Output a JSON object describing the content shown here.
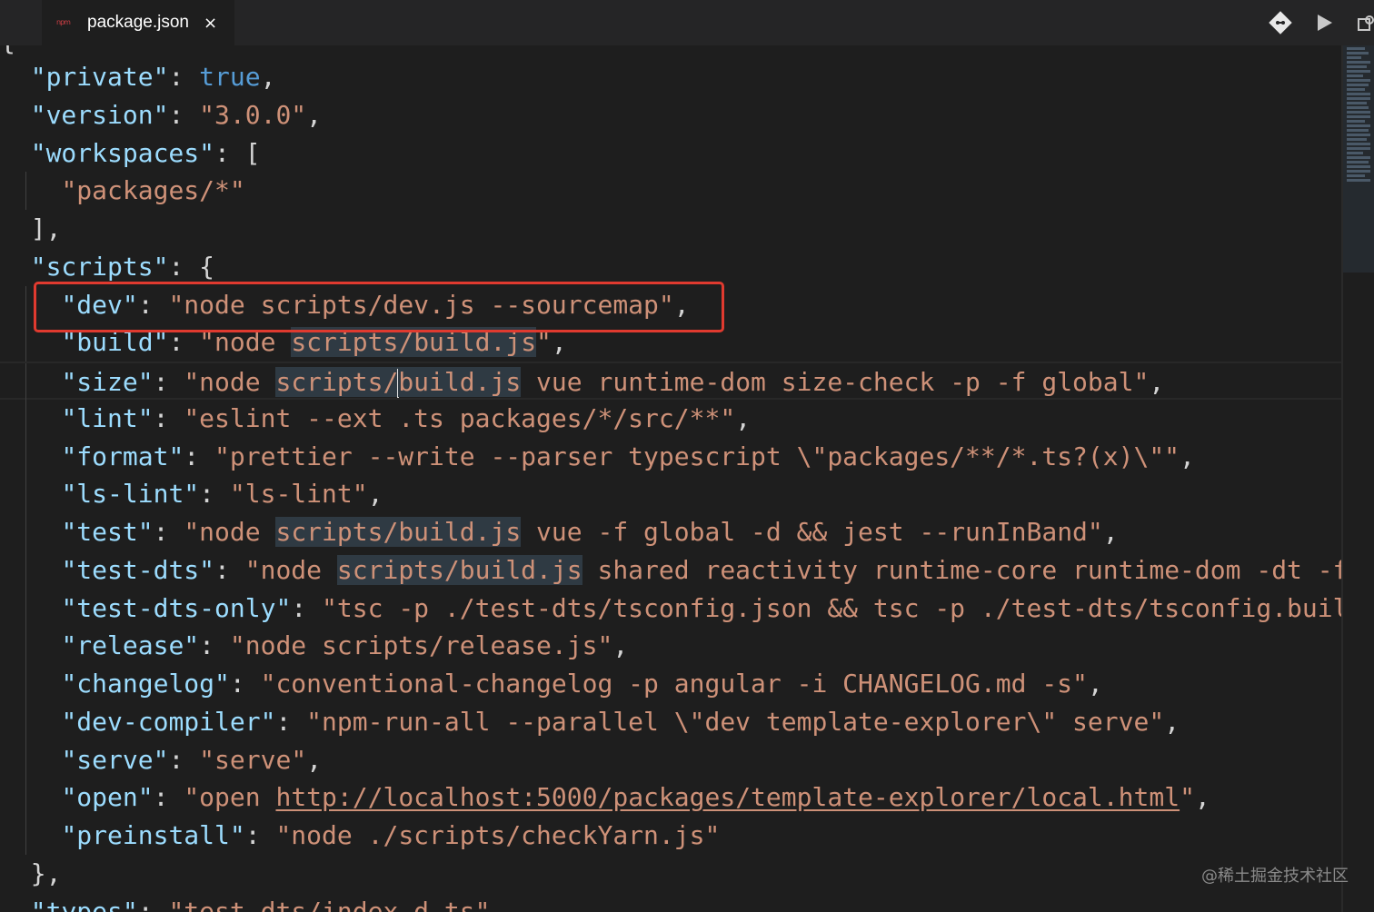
{
  "tab": {
    "label": "package.json",
    "icon": "npm-file-icon",
    "icon_text": "npm",
    "close": "×"
  },
  "actions": [
    {
      "name": "git-compare-icon"
    },
    {
      "name": "run-icon"
    },
    {
      "name": "open-preview-icon"
    }
  ],
  "code": {
    "top_brace": "{",
    "private_key": "\"private\"",
    "private_val": "true",
    "version_key": "\"version\"",
    "version_val": "\"3.0.0\"",
    "workspaces_key": "\"workspaces\"",
    "workspaces_open": "[",
    "workspaces_item": "\"packages/*\"",
    "workspaces_close": "],",
    "scripts_key": "\"scripts\"",
    "scripts_open": "{",
    "dev_key": "\"dev\"",
    "dev_val": "\"node scripts/dev.js --sourcemap\"",
    "build_key": "\"build\"",
    "build_val_a": "\"node ",
    "build_val_b": "scripts/build.js",
    "build_val_c": "\"",
    "size_key": "\"size\"",
    "size_val_a": "\"node ",
    "size_val_b1": "scripts/",
    "size_val_b2": "build.js",
    "size_val_c": " vue runtime-dom size-check -p -f global\"",
    "lint_key": "\"lint\"",
    "lint_val": "\"eslint --ext .ts packages/*/src/**\"",
    "format_key": "\"format\"",
    "format_val": "\"prettier --write --parser typescript \\\"packages/**/*.ts?(x)\\\"\"",
    "lslint_key": "\"ls-lint\"",
    "lslint_val": "\"ls-lint\"",
    "test_key": "\"test\"",
    "test_val_a": "\"node ",
    "test_val_b": "scripts/build.js",
    "test_val_c": " vue -f global -d && jest --runInBand\"",
    "testdts_key": "\"test-dts\"",
    "testdts_val_a": "\"node ",
    "testdts_val_b": "scripts/build.js",
    "testdts_val_c": " shared reactivity runtime-core runtime-dom -dt -f",
    "testdtsonly_key": "\"test-dts-only\"",
    "testdtsonly_val": "\"tsc -p ./test-dts/tsconfig.json && tsc -p ./test-dts/tsconfig.build",
    "release_key": "\"release\"",
    "release_val": "\"node scripts/release.js\"",
    "changelog_key": "\"changelog\"",
    "changelog_val": "\"conventional-changelog -p angular -i CHANGELOG.md -s\"",
    "devcompiler_key": "\"dev-compiler\"",
    "devcompiler_val": "\"npm-run-all --parallel \\\"dev template-explorer\\\" serve\"",
    "serve_key": "\"serve\"",
    "serve_val": "\"serve\"",
    "open_key": "\"open\"",
    "open_val_a": "\"open ",
    "open_val_url": "http://localhost:5000/packages/template-explorer/local.html",
    "open_val_c": "\"",
    "preinstall_key": "\"preinstall\"",
    "preinstall_val": "\"node ./scripts/checkYarn.js\"",
    "scripts_close": "},",
    "types_key": "\"types\"",
    "types_val": "\"test-dts/index.d.ts\""
  },
  "watermark": "@稀土掘金技术社区",
  "colors": {
    "key": "#9cdcfe",
    "string": "#ce9178",
    "boolean": "#569cd6",
    "highlight_box": "#e03a2f"
  }
}
